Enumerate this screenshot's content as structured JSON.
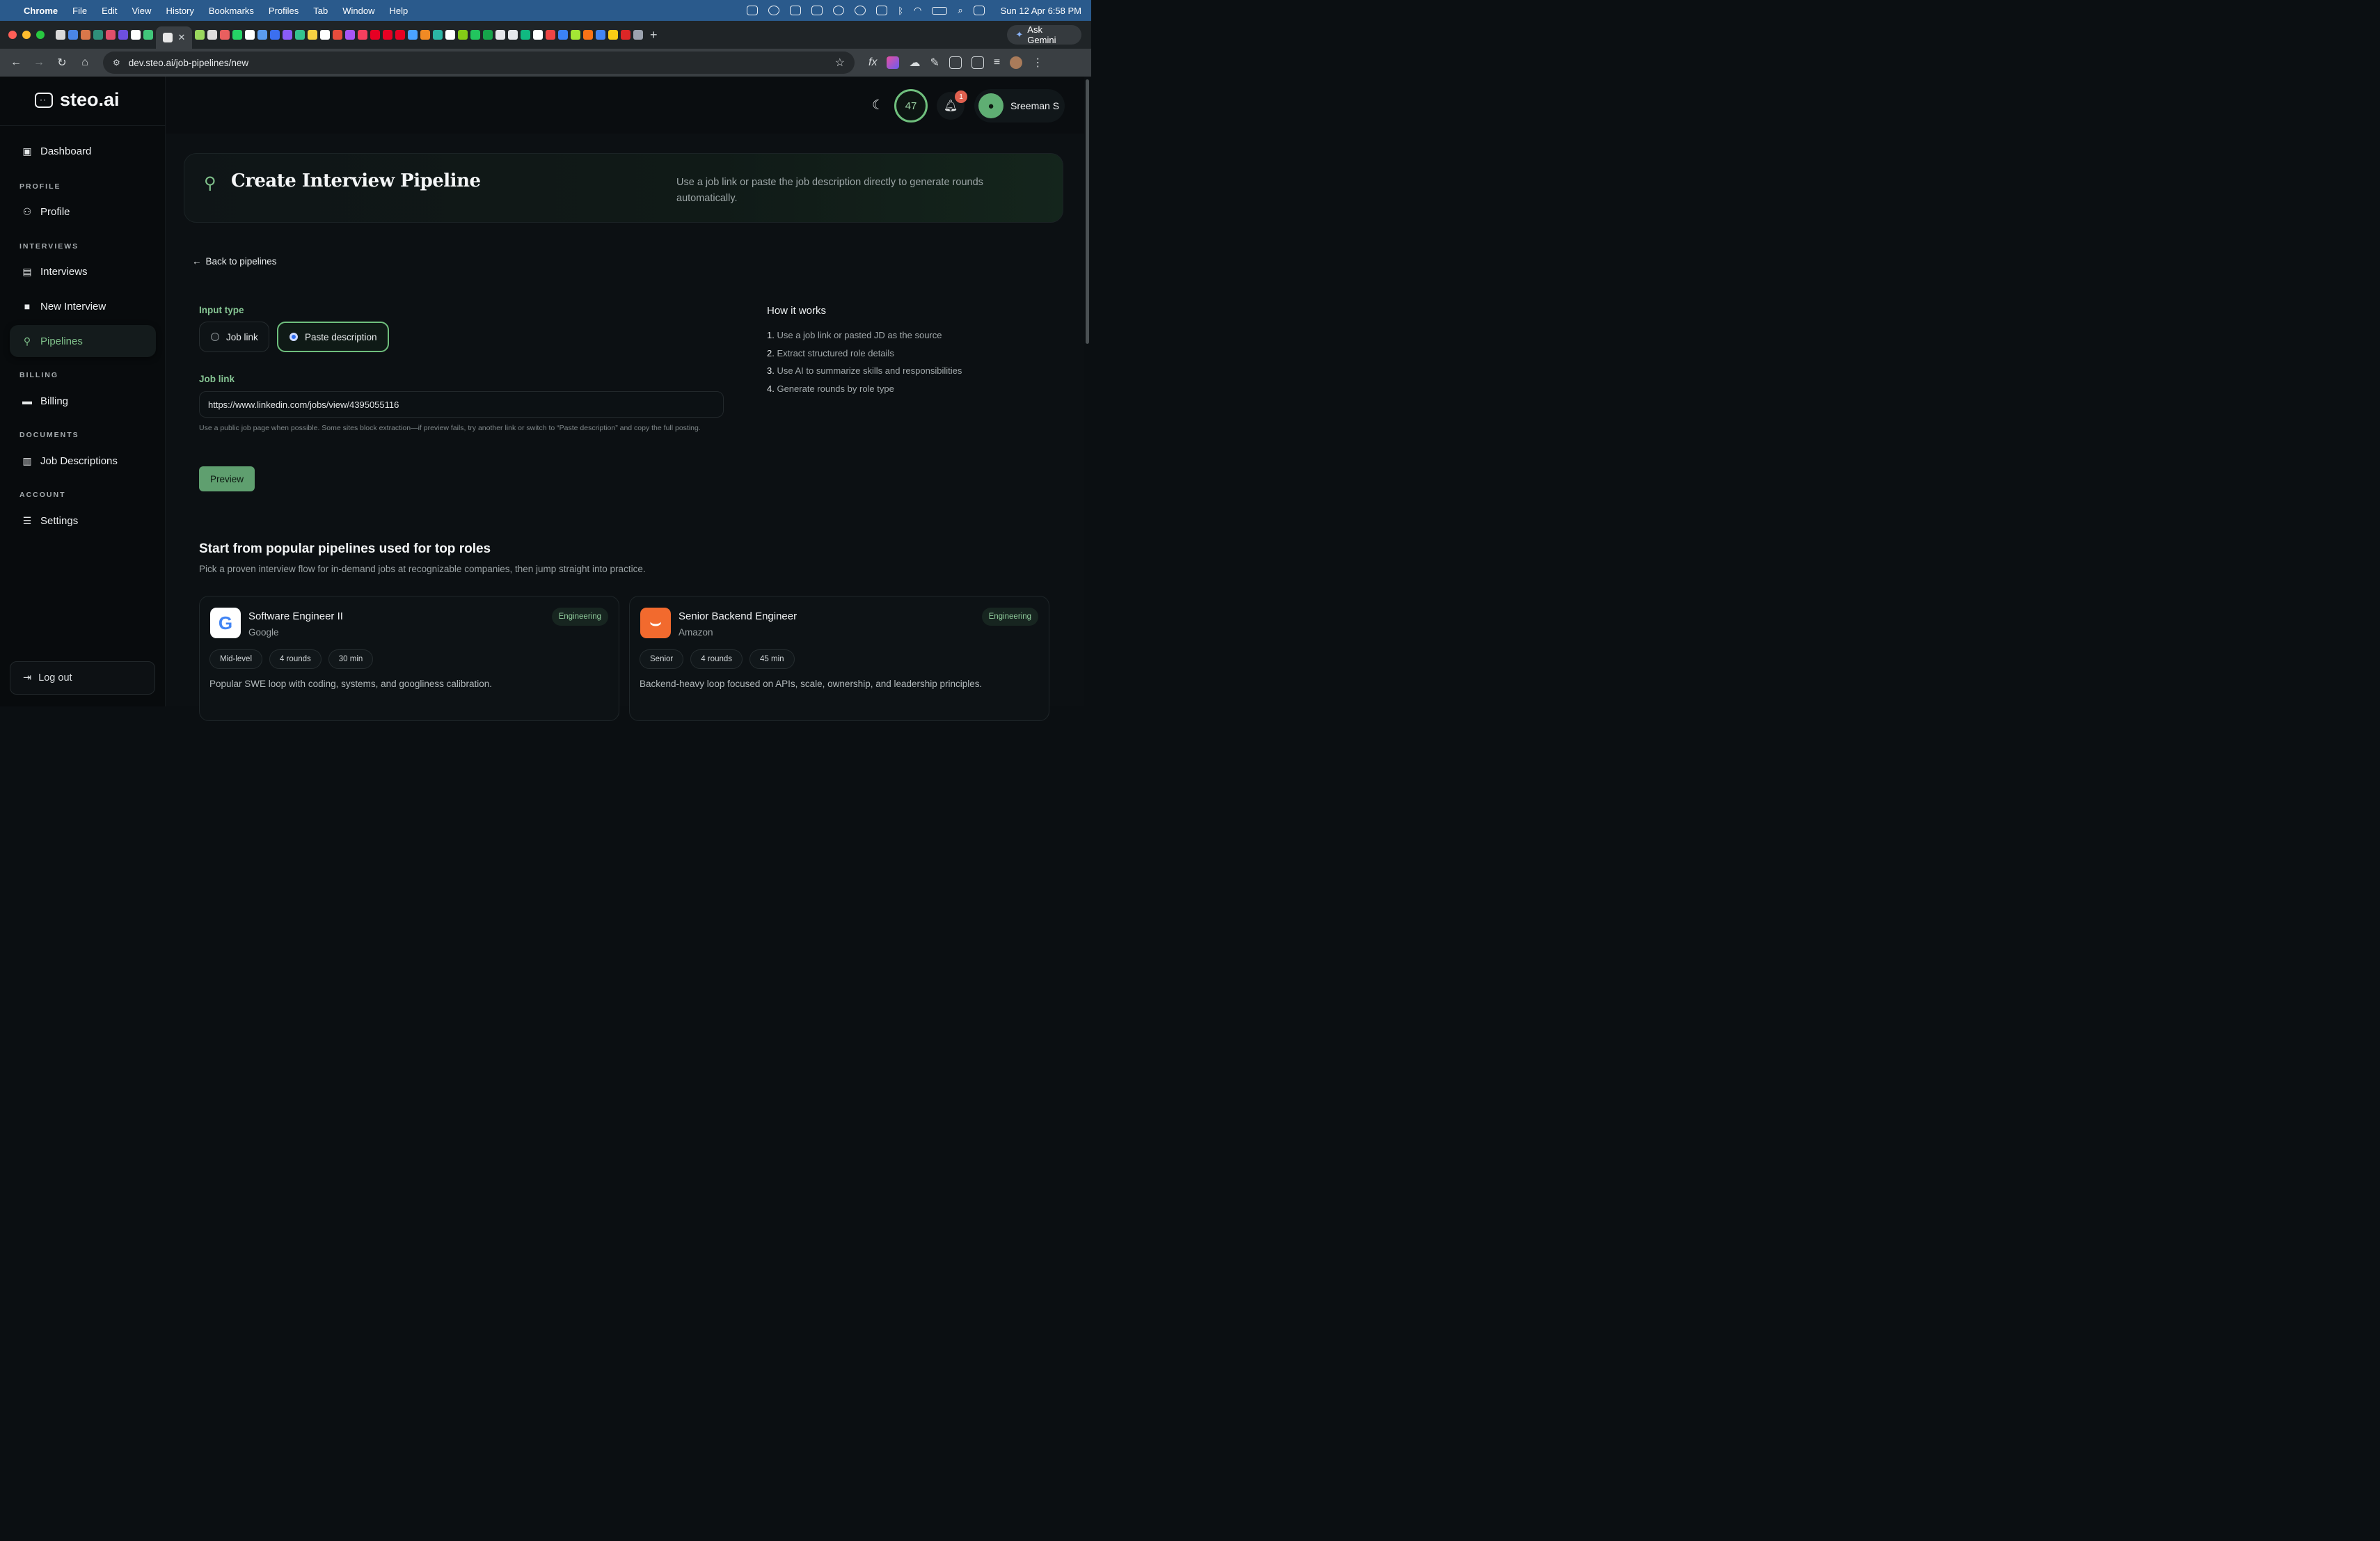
{
  "menubar": {
    "app": "Chrome",
    "items": [
      "File",
      "Edit",
      "View",
      "History",
      "Bookmarks",
      "Profiles",
      "Tab",
      "Window",
      "Help"
    ],
    "clock": "Sun 12 Apr  6:58 PM"
  },
  "browser": {
    "ask_gemini": "Ask Gemini",
    "url": "dev.steo.ai/job-pipelines/new"
  },
  "app": {
    "logo": "steo.ai",
    "score": "47",
    "notifications": "1",
    "user_name": "Sreeman S",
    "accent_color": "#6fbf7d"
  },
  "sidebar": {
    "dashboard": "Dashboard",
    "section_profile": "PROFILE",
    "profile": "Profile",
    "section_interviews": "INTERVIEWS",
    "interviews": "Interviews",
    "new_interview": "New Interview",
    "pipelines": "Pipelines",
    "section_billing": "BILLING",
    "billing": "Billing",
    "section_documents": "DOCUMENTS",
    "job_descriptions": "Job Descriptions",
    "section_account": "ACCOUNT",
    "settings": "Settings",
    "logout": "Log out"
  },
  "hero": {
    "title": "Create Interview Pipeline",
    "description": "Use a job link or paste the job description directly to generate rounds automatically."
  },
  "form": {
    "back": "Back to pipelines",
    "input_type_label": "Input type",
    "option_job_link": "Job link",
    "option_paste": "Paste description",
    "selected": "Paste description",
    "job_link_label": "Job link",
    "job_link_value": "https://www.linkedin.com/jobs/view/4395055116",
    "hint": "Use a public job page when possible. Some sites block extraction—if preview fails, try another link or switch to “Paste description” and copy the full posting.",
    "preview_button": "Preview"
  },
  "how_it_works": {
    "title": "How it works",
    "steps": [
      {
        "num": "1.",
        "text": "Use a job link or pasted JD as the source"
      },
      {
        "num": "2.",
        "text": "Extract structured role details"
      },
      {
        "num": "3.",
        "text": "Use AI to summarize skills and responsibilities"
      },
      {
        "num": "4.",
        "text": "Generate rounds by role type"
      }
    ]
  },
  "popular": {
    "title": "Start from popular pipelines used for top roles",
    "subtitle": "Pick a proven interview flow for in-demand jobs at recognizable companies, then jump straight into practice.",
    "cards": [
      {
        "title": "Software Engineer II",
        "company": "Google",
        "tag": "Engineering",
        "chips": [
          "Mid-level",
          "4 rounds",
          "30 min"
        ],
        "description": "Popular SWE loop with coding, systems, and googliness calibration.",
        "logo_icon": "google-logo"
      },
      {
        "title": "Senior Backend Engineer",
        "company": "Amazon",
        "tag": "Engineering",
        "chips": [
          "Senior",
          "4 rounds",
          "45 min"
        ],
        "description": "Backend-heavy loop focused on APIs, scale, ownership, and leadership principles.",
        "logo_icon": "amazon-logo"
      }
    ]
  }
}
